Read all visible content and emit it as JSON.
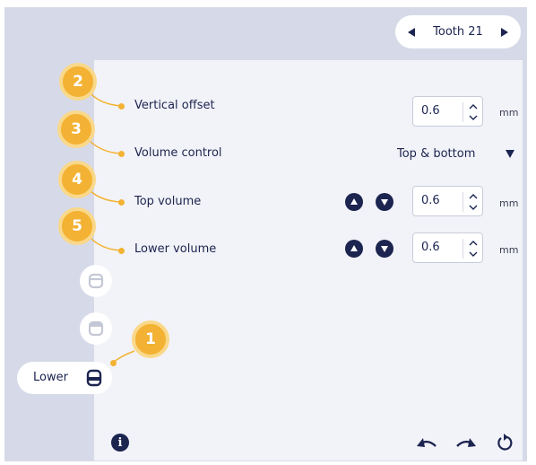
{
  "tooth_nav": {
    "label": "Tooth 21"
  },
  "fields": {
    "vertical_offset": {
      "label": "Vertical offset",
      "value": "0.6",
      "unit": "mm"
    },
    "volume_control": {
      "label": "Volume control",
      "value": "Top & bottom"
    },
    "top_volume": {
      "label": "Top volume",
      "value": "0.6",
      "unit": "mm"
    },
    "lower_volume": {
      "label": "Lower volume",
      "value": "0.6",
      "unit": "mm"
    }
  },
  "callouts": {
    "c1": "1",
    "c2": "2",
    "c3": "3",
    "c4": "4",
    "c5": "5"
  },
  "mode": {
    "selected_label": "Lower"
  },
  "colors": {
    "accent": "#f3b233",
    "primary": "#1c2450",
    "panel": "#f2f3f8",
    "frame": "#d6dae8",
    "disabled": "#c4c8d6"
  }
}
